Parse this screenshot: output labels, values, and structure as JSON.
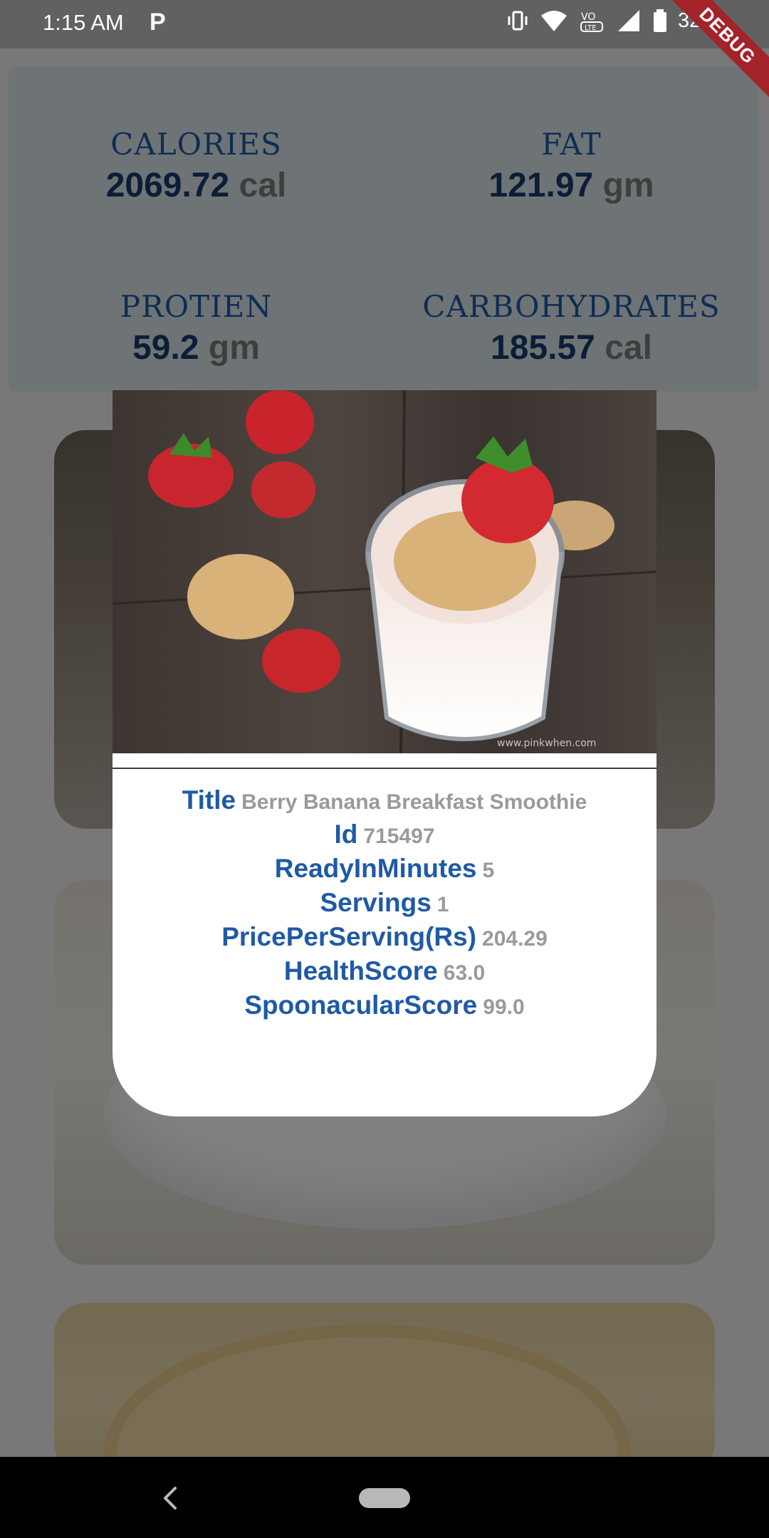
{
  "status_bar": {
    "time": "1:15 AM",
    "app_icon": "P",
    "battery": "32%",
    "icons": [
      "vibrate-icon",
      "wifi-icon",
      "volte-icon",
      "signal-icon",
      "battery-icon"
    ]
  },
  "debug_banner": "DEBUG",
  "nutrition": [
    {
      "label": "CALORIES",
      "value": "2069.72",
      "unit": "cal"
    },
    {
      "label": "FAT",
      "value": "121.97",
      "unit": "gm"
    },
    {
      "label": "PROTIEN",
      "value": "59.2",
      "unit": "gm"
    },
    {
      "label": "CARBOHYDRATES",
      "value": "185.57",
      "unit": "cal"
    }
  ],
  "dialog": {
    "image_caption": "www.pinkwhen.com",
    "fields": [
      {
        "label": "Title",
        "value": "Berry Banana Breakfast Smoothie"
      },
      {
        "label": "Id",
        "value": "715497"
      },
      {
        "label": "ReadyInMinutes",
        "value": "5"
      },
      {
        "label": "Servings",
        "value": "1"
      },
      {
        "label": "PricePerServing(Rs)",
        "value": "204.29"
      },
      {
        "label": "HealthScore",
        "value": "63.0"
      },
      {
        "label": "SpoonacularScore",
        "value": "99.0"
      }
    ]
  },
  "colors": {
    "label_blue": "#1f5aa6",
    "value_grey": "#9a9a9a",
    "nutrition_bg": "#dde8ea",
    "debug_red": "#a32329"
  }
}
